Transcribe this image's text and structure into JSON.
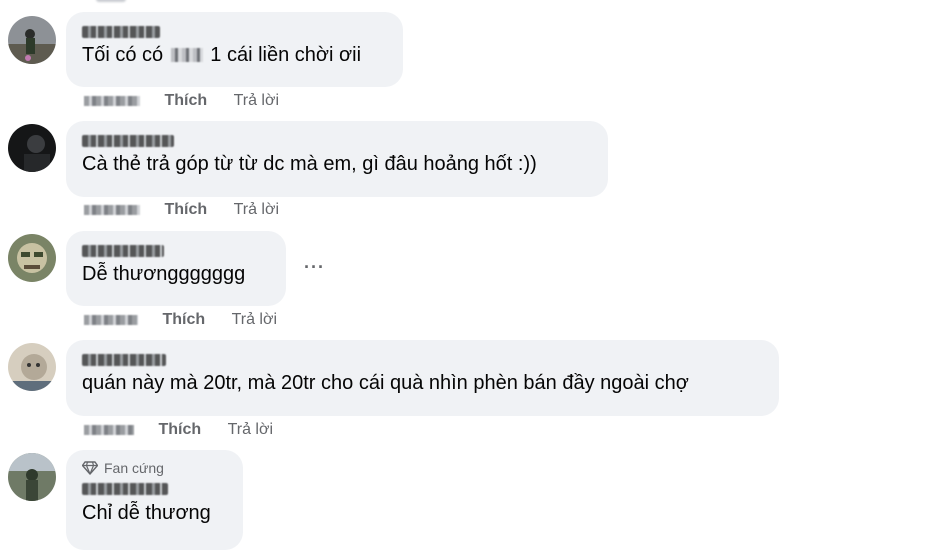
{
  "comments": [
    {
      "text_before": "Tối có có",
      "text_after": "1 cái liền chời ơii",
      "like_label": "Thích",
      "reply_label": "Trả lời",
      "avatar_colors": [
        "#8a8f95",
        "#5d5c55",
        "#2f3b2b"
      ]
    },
    {
      "text": "Cà thẻ trả góp từ từ dc mà em, gì đâu hoảng hốt :))",
      "like_label": "Thích",
      "reply_label": "Trả lời",
      "avatar_colors": [
        "#1d1e20",
        "#3a3c3f",
        "#0e0f10"
      ]
    },
    {
      "text": "Dễ thươnggggggg",
      "like_label": "Thích",
      "reply_label": "Trả lời",
      "more_label": "···",
      "avatar_colors": [
        "#6f7a5a",
        "#c9c4a4",
        "#3e4a2f"
      ]
    },
    {
      "text": "quán này mà 20tr, mà 20tr cho cái quà nhìn phèn bán đầy ngoài chợ",
      "like_label": "Thích",
      "reply_label": "Trả lời",
      "avatar_colors": [
        "#d9d1c3",
        "#9a9184",
        "#4b5a6a"
      ]
    },
    {
      "badge_label": "Fan cứng",
      "badge_icon": "diamond-icon",
      "text": "Chỉ dễ thương",
      "avatar_colors": [
        "#2f3a2c",
        "#6b7560",
        "#b9c2c9"
      ]
    }
  ]
}
